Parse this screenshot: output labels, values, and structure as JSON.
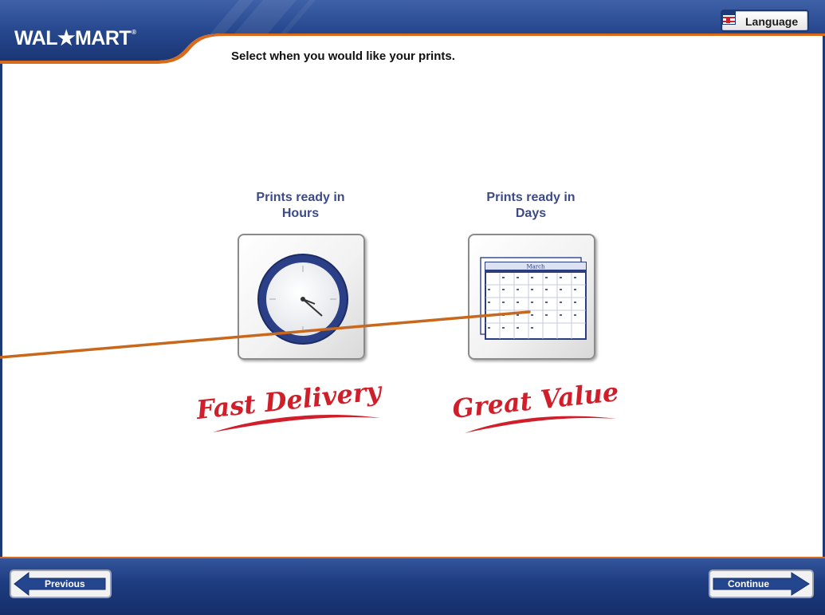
{
  "header": {
    "logo_text": "WAL★MART",
    "language_label": "Language"
  },
  "instruction": "Select when you would like your prints.",
  "options": [
    {
      "title_line1": "Prints ready in",
      "title_line2": "Hours",
      "icon": "clock-icon",
      "slogan": "Fast Delivery"
    },
    {
      "title_line1": "Prints ready in",
      "title_line2": "Days",
      "icon": "calendar-icon",
      "slogan": "Great Value"
    }
  ],
  "calendar": {
    "month": "March"
  },
  "footer": {
    "previous_label": "Previous",
    "continue_label": "Continue"
  },
  "colors": {
    "brand_blue": "#1f3d82",
    "accent_orange": "#d96a1a",
    "title_blue": "#3c4a86",
    "slogan_red": "#d01f2a"
  }
}
